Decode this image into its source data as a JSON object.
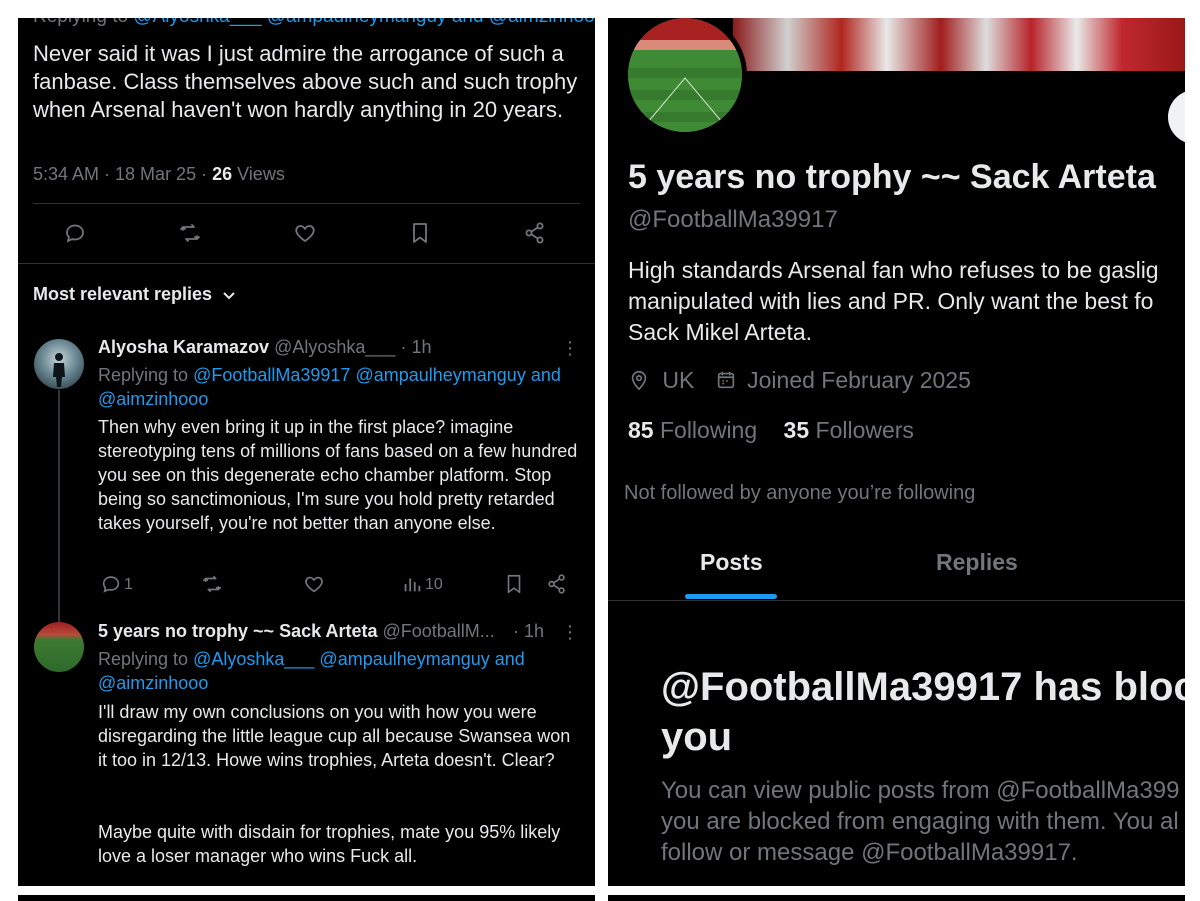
{
  "left": {
    "cut_reply": {
      "prefix": "Replying to",
      "mentions": "@Alyoshka___ @ampaulheymanguy and @aimzinhooo"
    },
    "tweet": {
      "text": "Never said it was I just admire the arrogance of such a fanbase. Class themselves above such and such trophy when Arsenal haven't won hardly anything in 20 years.",
      "time": "5:34 AM · 18 Mar 25 · ",
      "views_count": "26",
      "views_label": "Views"
    },
    "most_relevant": "Most relevant replies",
    "replies": [
      {
        "name": "Alyosha Karamazov",
        "handle": "@Alyoshka___",
        "age": "· 1h",
        "replying_prefix": "Replying to",
        "replying_line1": "@FootballMa39917 @ampaulheymanguy and",
        "replying_line2": "@aimzinhooo",
        "text": "Then why even bring it up in the first place? imagine stereotyping tens of millions of fans based on a few hundred you see on this degenerate echo chamber platform. Stop being so sanctimonious, I'm sure you hold pretty retarded takes yourself, you're not better than anyone else.",
        "reply_count": "1",
        "views": "10"
      },
      {
        "name": "5 years no trophy ~~ Sack Arteta",
        "handle": "@FootballM...",
        "age": "· 1h",
        "replying_prefix": "Replying to",
        "replying_line1": "@Alyoshka___ @ampaulheymanguy and",
        "replying_line2": "@aimzinhooo",
        "text_p1": "I'll draw my own conclusions on you with how you were disregarding the little league cup all because Swansea won it too in 12/13. Howe wins trophies, Arteta doesn't. Clear?",
        "text_p2": " Maybe quite with disdain for trophies, mate you 95% likely love a loser manager who wins Fuck all."
      }
    ]
  },
  "right": {
    "display_name": "5 years no trophy ~~ Sack Arteta",
    "handle": "@FootballMa39917",
    "bio_line1": "High standards Arsenal fan who refuses to be gaslig",
    "bio_line2": "manipulated with lies and PR.  Only want the best fo",
    "bio_line3": "Sack Mikel Arteta.",
    "location": "UK",
    "joined": "Joined February 2025",
    "following_count": "85",
    "following_label": "Following",
    "followers_count": "35",
    "followers_label": "Followers",
    "not_followed": "Not followed by anyone you’re following",
    "tabs": [
      "Posts",
      "Replies"
    ],
    "blocked_title": "@FootballMa39917 has bloc you",
    "blocked_title_line1": "@FootballMa39917 has bloc",
    "blocked_title_line2": "you",
    "blocked_line1": "You can view public posts from @FootballMa399",
    "blocked_line2": "you are blocked from engaging with them. You al",
    "blocked_line3": "follow or message @FootballMa39917."
  },
  "colors": {
    "accent": "#1d9bf0",
    "muted": "#71767b",
    "text": "#e7e9ea",
    "background": "#000000",
    "divider": "#2f3336"
  }
}
